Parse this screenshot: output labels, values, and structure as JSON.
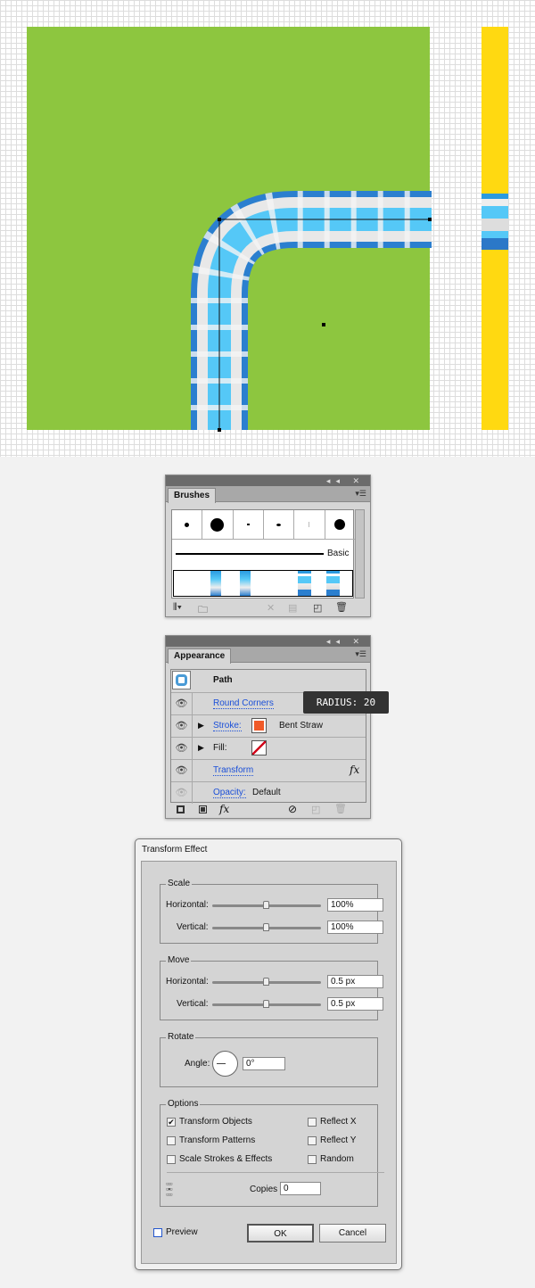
{
  "colors": {
    "artboard": "#8dc63f",
    "yellow": "#ffd911",
    "blue": "#2b9ae0",
    "light_blue": "#55c8f7",
    "orange": "#f05a28"
  },
  "brushes": {
    "tab": "Brushes",
    "basic_label": "Basic",
    "icons": [
      "brush-libraries-icon",
      "brush-library-folder-icon",
      "remove-stroke-icon",
      "options-icon",
      "new-brush-icon",
      "delete-icon"
    ]
  },
  "appearance": {
    "tab": "Appearance",
    "title": "Path",
    "tooltip": "RADIUS: 20",
    "rows": [
      {
        "label": "Round Corners"
      },
      {
        "label": "Stroke:",
        "value": "Bent Straw"
      },
      {
        "label": "Fill:"
      },
      {
        "label": "Transform",
        "fx": "fx"
      },
      {
        "label": "Opacity:",
        "value": "Default"
      }
    ],
    "footer_fx": "fx"
  },
  "dialog": {
    "title": "Transform Effect",
    "scale": {
      "label": "Scale",
      "h_label": "Horizontal:",
      "h_value": "100%",
      "v_label": "Vertical:",
      "v_value": "100%"
    },
    "move": {
      "label": "Move",
      "h_label": "Horizontal:",
      "h_value": "0.5 px",
      "v_label": "Vertical:",
      "v_value": "0.5 px"
    },
    "rotate": {
      "label": "Rotate",
      "angle_label": "Angle:",
      "angle_value": "0°"
    },
    "options": {
      "label": "Options",
      "transform_objects": "Transform Objects",
      "transform_patterns": "Transform Patterns",
      "scale_strokes": "Scale Strokes & Effects",
      "reflect_x": "Reflect X",
      "reflect_y": "Reflect Y",
      "random": "Random",
      "copies_label": "Copies",
      "copies_value": "0",
      "checked": {
        "transform_objects": true,
        "transform_patterns": false,
        "scale_strokes": false,
        "reflect_x": false,
        "reflect_y": false,
        "random": false
      }
    },
    "preview": "Preview",
    "ok": "OK",
    "cancel": "Cancel"
  }
}
